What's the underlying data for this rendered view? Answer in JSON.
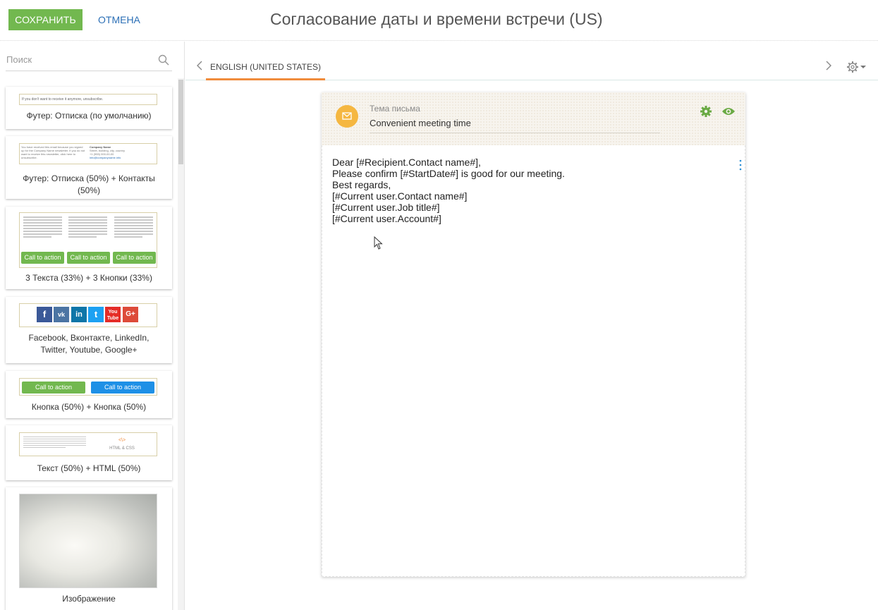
{
  "header": {
    "save_label": "СОХРАНИТЬ",
    "cancel_label": "ОТМЕНА",
    "title": "Согласование даты и времени встречи (US)"
  },
  "sidebar": {
    "search_placeholder": "Поиск",
    "blocks": [
      {
        "label": "Футер: Отписка (по умолчанию)",
        "thumb_text": "If you don't want to receive it anymore, unsubscribe."
      },
      {
        "label": "Футер: Отписка (50%) + Контакты (50%)",
        "thumb_left": "You have received this email because you signed up for the Company Name newsletter. If you do not want to receive this newsletter, click here to unsubscribe.",
        "thumb_company": "Company Name",
        "thumb_address": "Street, building, city, country",
        "thumb_phone": "+1 (555) 000-00-00",
        "thumb_email": "info@companyname.info"
      },
      {
        "label": "3 Текста (33%) + 3 Кнопки (33%)",
        "cta_label": "Call to action"
      },
      {
        "label": "Facebook, Вконтакте, LinkedIn, Twitter, Youtube, Google+",
        "social_icons": [
          "f",
          "vk",
          "in",
          "t",
          "You Tube",
          "G+"
        ]
      },
      {
        "label": "Кнопка (50%) + Кнопка (50%)",
        "cta_left": "Call to action",
        "cta_right": "Call to action"
      },
      {
        "label": "Текст (50%) + HTML (50%)",
        "html_code": "<\\>",
        "html_label": "HTML & CSS"
      },
      {
        "label": "Изображение"
      }
    ]
  },
  "editor": {
    "language_tab": "ENGLISH (UNITED STATES)",
    "subject_label": "Тема письма",
    "subject_value": "Convenient meeting time",
    "body_lines": [
      "Dear [#Recipient.Contact name#],",
      "Please confirm [#StartDate#] is good for our meeting.",
      "Best regards,",
      "[#Current user.Contact name#]",
      "[#Current user.Job title#]",
      "[#Current user.Account#]"
    ]
  },
  "colors": {
    "save_green": "#72b84f",
    "cancel_blue": "#2b6fb6",
    "tab_orange": "#f08c3c",
    "envelope_yellow": "#f5b741",
    "accent_green": "#6aaa44",
    "blue_button": "#1e90e6"
  },
  "icons": [
    "search-icon",
    "chevron-left-icon",
    "chevron-right-icon",
    "gear-icon",
    "caret-down-icon",
    "envelope-icon",
    "eye-icon",
    "more-vertical-icon",
    "mouse-cursor-icon"
  ]
}
